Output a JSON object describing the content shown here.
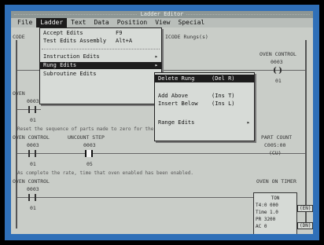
{
  "window": {
    "title": "Ladder Editor"
  },
  "menubar": {
    "items": [
      {
        "label": "File",
        "active": false
      },
      {
        "label": "Ladder",
        "active": true
      },
      {
        "label": "Text",
        "active": false
      },
      {
        "label": "Data",
        "active": false
      },
      {
        "label": "Position",
        "active": false
      },
      {
        "label": "View",
        "active": false
      },
      {
        "label": "Special",
        "active": false
      }
    ]
  },
  "ladder_menu": {
    "accept_edits": {
      "label": "Accept Edits",
      "shortcut": "F9"
    },
    "test_edits": {
      "label": "Test Edits Assembly",
      "shortcut": "Alt+A"
    },
    "instruction_edits": {
      "label": "Instruction Edits",
      "arrow": "▸"
    },
    "rung_edits": {
      "label": "Rung Edits",
      "arrow": "▸"
    },
    "subroutine_edits": {
      "label": "Subroutine Edits",
      "arrow": "▸"
    }
  },
  "rung_submenu": {
    "delete_rung": {
      "label": "Delete Rung",
      "shortcut": "(Del R)"
    },
    "add_above": {
      "label": "Add Above",
      "shortcut": "(Ins T)"
    },
    "insert_below": {
      "label": "Insert Below",
      "shortcut": "(Ins L)"
    },
    "range_edits": {
      "label": "Range Edits",
      "arrow": "▸"
    }
  },
  "ladder": {
    "partial_header": "CODE",
    "partial_header2": "ICODE Rungs(s)",
    "rung1": {
      "label_right": "OVEN CONTROL",
      "addr_right": "0003",
      "bit_right": "01"
    },
    "rung2": {
      "label": "OVEN",
      "addr": "0003",
      "bit": "01"
    },
    "help1": "Reset the sequence of parts made to zero for the operator from",
    "rung3": {
      "label1": "OVEN CONTROL",
      "addr1": "0003",
      "bit1": "01",
      "label2": "UNCOUNT STEP",
      "addr2": "0003",
      "bit2": "05",
      "label_right": "PART COUNT",
      "addr_right": "C005:00",
      "value_right": "(CU)"
    },
    "help2": "As complete the rate, time that oven enabled has been enabled.",
    "rung4": {
      "label": "OVEN CONTROL",
      "addr": "0003",
      "bit": "01"
    },
    "timer": {
      "title": "OVEN ON TIMER",
      "type": "TON",
      "timer_addr": "T4:0 000",
      "time_base": "Time 1.0",
      "preset": "PR 3200",
      "accum": "AC 0",
      "en_tag": "(EN)",
      "dn_tag": "(DN)"
    }
  }
}
